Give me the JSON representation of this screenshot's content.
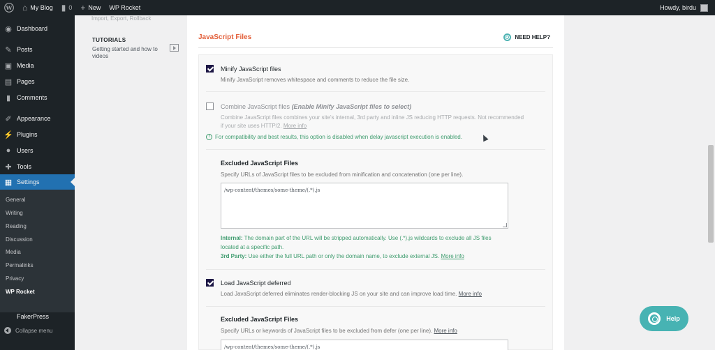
{
  "adminbar": {
    "site_name": "My Blog",
    "comments_count": "0",
    "new_label": "New",
    "plugin_label": "WP Rocket",
    "howdy": "Howdy, birdu"
  },
  "sidebar": {
    "items": [
      {
        "label": "Dashboard",
        "icon": "dashboard-icon"
      },
      {
        "label": "Posts",
        "icon": "pin-icon"
      },
      {
        "label": "Media",
        "icon": "media-icon"
      },
      {
        "label": "Pages",
        "icon": "pages-icon"
      },
      {
        "label": "Comments",
        "icon": "comment-icon"
      },
      {
        "label": "Appearance",
        "icon": "brush-icon"
      },
      {
        "label": "Plugins",
        "icon": "plug-icon"
      },
      {
        "label": "Users",
        "icon": "user-icon"
      },
      {
        "label": "Tools",
        "icon": "wrench-icon"
      },
      {
        "label": "Settings",
        "icon": "settings-icon"
      }
    ],
    "submenu": [
      "General",
      "Writing",
      "Reading",
      "Discussion",
      "Media",
      "Permalinks",
      "Privacy",
      "WP Rocket"
    ],
    "fakerpress": "FakerPress",
    "collapse": "Collapse menu"
  },
  "rocket_nav": {
    "top_fade": "Import, Export, Rollback",
    "tutorials_title": "TUTORIALS",
    "tutorials_sub": "Getting started and how to videos"
  },
  "main": {
    "section_title": "JavaScript Files",
    "need_help": "NEED HELP?",
    "minify": {
      "title": "Minify JavaScript files",
      "checked": true,
      "desc": "Minify JavaScript removes whitespace and comments to reduce the file size."
    },
    "combine": {
      "title": "Combine JavaScript files",
      "title_note": "(Enable Minify JavaScript files to select)",
      "checked": false,
      "desc_line1": "Combine JavaScript files combines your site's internal, 3rd party and inline JS reducing HTTP requests. Not recommended",
      "desc_line2": "if your site uses HTTP/2.",
      "more_info": "More info",
      "notice": "For compatibility and best results, this option is disabled when delay javascript execution is enabled."
    },
    "excluded1": {
      "title": "Excluded JavaScript Files",
      "desc": "Specify URLs of JavaScript files to be excluded from minification and concatenation (one per line).",
      "value": "/wp-content/themes/some-theme/(.*).js",
      "internal_label": "Internal:",
      "internal_text": "The domain part of the URL will be stripped automatically. Use (.*).js wildcards to exclude all JS files located at a specific path.",
      "third_label": "3rd Party:",
      "third_text": "Use either the full URL path or only the domain name, to exclude external JS.",
      "more_info": "More info"
    },
    "deferred": {
      "title": "Load JavaScript deferred",
      "checked": true,
      "desc": "Load JavaScript deferred eliminates render-blocking JS on your site and can improve load time.",
      "more_info": "More info"
    },
    "excluded2": {
      "title": "Excluded JavaScript Files",
      "desc": "Specify URLs or keywords of JavaScript files to be excluded from defer (one per line).",
      "more_info": "More info",
      "value": "/wp-content/themes/some-theme/(.*).js"
    }
  },
  "help_bubble": "Help",
  "colors": {
    "accent": "#e3603b",
    "admin_dark": "#1d2327",
    "active_blue": "#2271b1",
    "green": "#3d9b6d",
    "teal": "#47b3b3"
  }
}
